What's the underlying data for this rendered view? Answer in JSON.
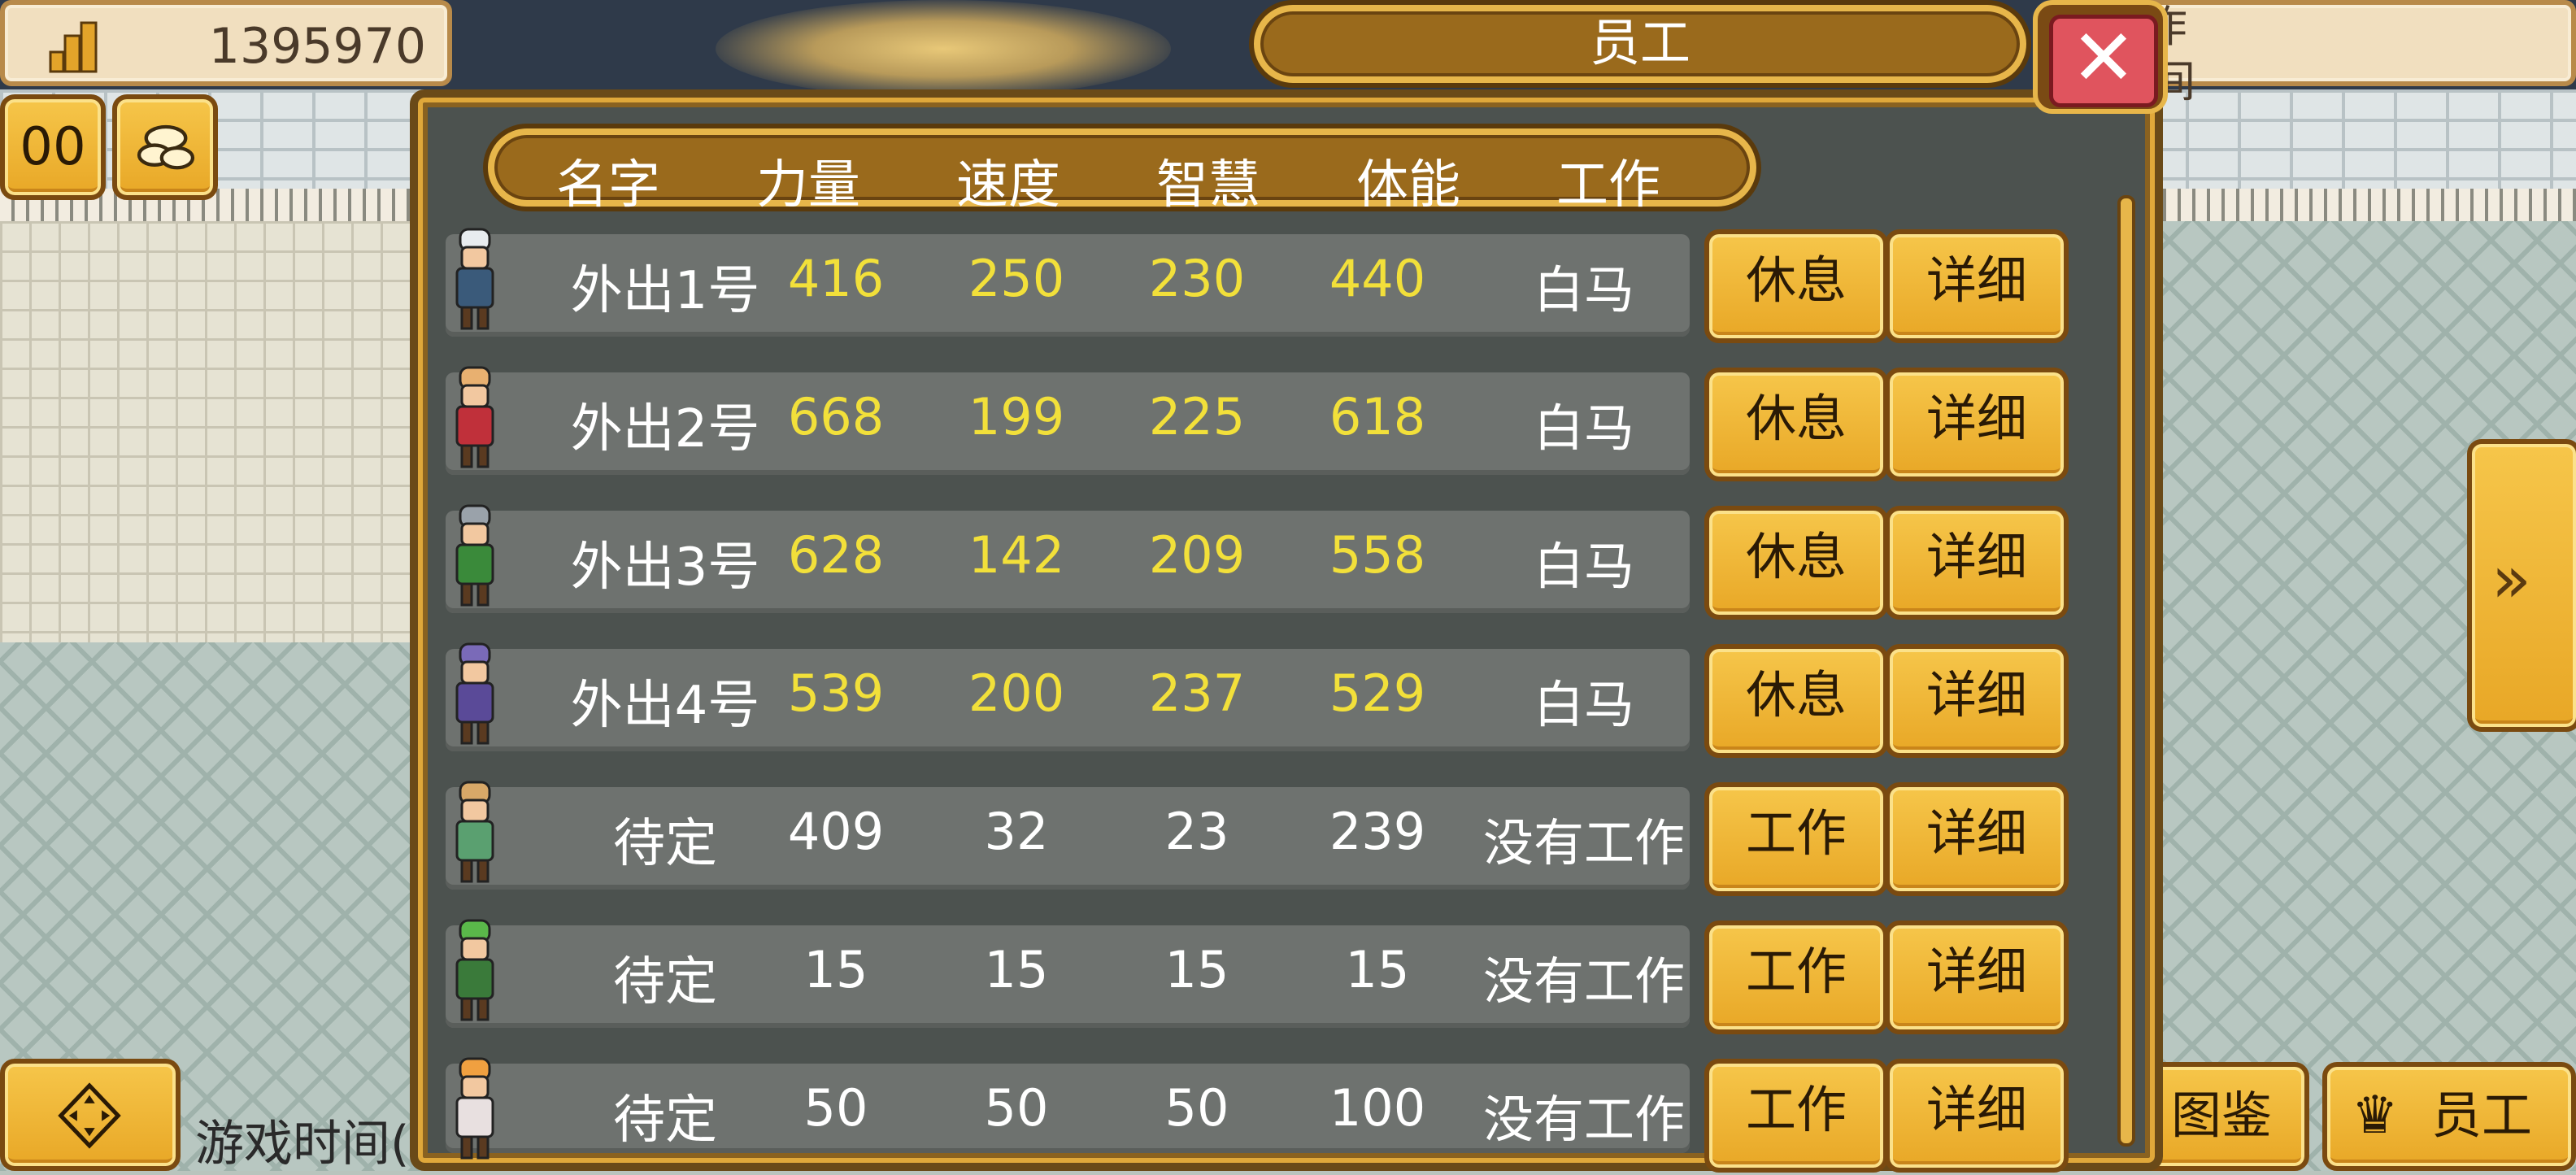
{
  "hud": {
    "money": "1395970",
    "top_right_fragment_1": "作",
    "top_right_fragment_2": "间",
    "pause_label": "00",
    "game_time_label": "游戏时间(",
    "illustrated_label": "图鉴",
    "staff_label": "员工"
  },
  "dialog": {
    "title": "员工",
    "close_symbol": "✕",
    "columns": [
      "名字",
      "力量",
      "速度",
      "智慧",
      "体能",
      "工作"
    ],
    "rows": [
      {
        "name": "外出1号",
        "strength": "416",
        "speed": "250",
        "wisdom": "230",
        "stamina": "440",
        "job": "白马",
        "action": "休息",
        "detail": "详细",
        "highlight": true
      },
      {
        "name": "外出2号",
        "strength": "668",
        "speed": "199",
        "wisdom": "225",
        "stamina": "618",
        "job": "白马",
        "action": "休息",
        "detail": "详细",
        "highlight": true
      },
      {
        "name": "外出3号",
        "strength": "628",
        "speed": "142",
        "wisdom": "209",
        "stamina": "558",
        "job": "白马",
        "action": "休息",
        "detail": "详细",
        "highlight": true
      },
      {
        "name": "外出4号",
        "strength": "539",
        "speed": "200",
        "wisdom": "237",
        "stamina": "529",
        "job": "白马",
        "action": "休息",
        "detail": "详细",
        "highlight": true
      },
      {
        "name": "待定",
        "strength": "409",
        "speed": "32",
        "wisdom": "23",
        "stamina": "239",
        "job": "没有工作",
        "action": "工作",
        "detail": "详细",
        "highlight": false
      },
      {
        "name": "待定",
        "strength": "15",
        "speed": "15",
        "wisdom": "15",
        "stamina": "15",
        "job": "没有工作",
        "action": "工作",
        "detail": "详细",
        "highlight": false
      },
      {
        "name": "待定",
        "strength": "50",
        "speed": "50",
        "wisdom": "50",
        "stamina": "100",
        "job": "没有工作",
        "action": "工作",
        "detail": "详细",
        "highlight": false
      }
    ]
  },
  "colors": {
    "stat_highlight": "#f2e03a",
    "stat_normal": "#ffffff",
    "gold": "#f0b83a",
    "panel": "#4c524f"
  },
  "icons": [
    "building-stats-icon",
    "pause-icon",
    "speed-icon",
    "fast-forward-icon",
    "menu-dpad-icon",
    "crown-icon",
    "close-icon"
  ]
}
